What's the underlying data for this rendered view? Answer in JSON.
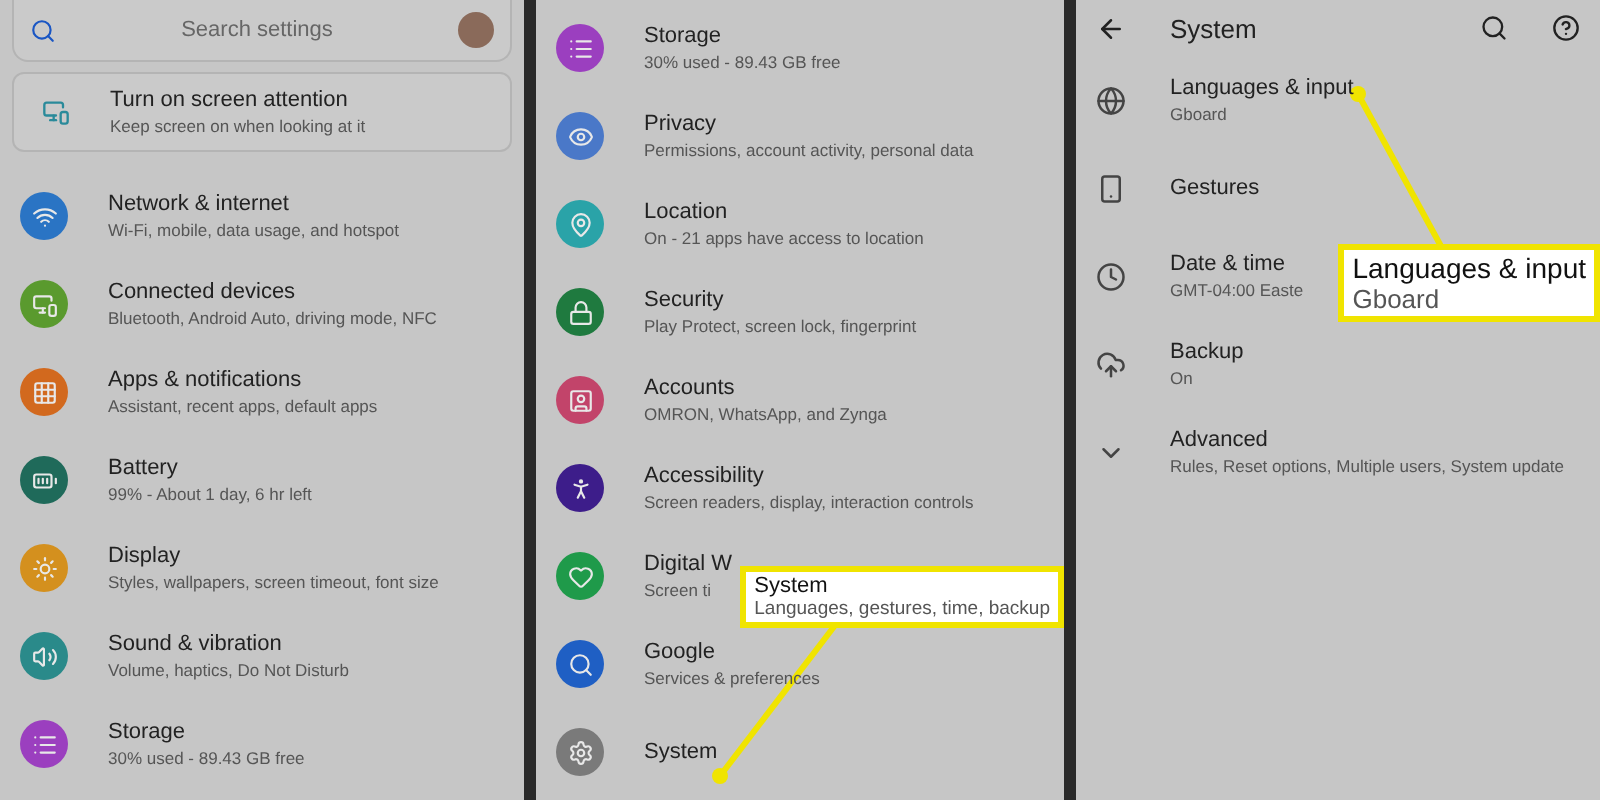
{
  "panels": [
    {
      "kind": "home",
      "search": {
        "placeholder": "Search settings"
      },
      "suggestion": {
        "title": "Turn on screen attention",
        "subtitle": "Keep screen on when looking at it"
      },
      "items": [
        {
          "title": "Network & internet",
          "subtitle": "Wi-Fi, mobile, data usage, and hotspot",
          "color": "#2a74c4"
        },
        {
          "title": "Connected devices",
          "subtitle": "Bluetooth, Android Auto, driving mode, NFC",
          "color": "#5a9a2e"
        },
        {
          "title": "Apps & notifications",
          "subtitle": "Assistant, recent apps, default apps",
          "color": "#d2691e"
        },
        {
          "title": "Battery",
          "subtitle": "99% - About 1 day, 6 hr left",
          "color": "#1f6a5a"
        },
        {
          "title": "Display",
          "subtitle": "Styles, wallpapers, screen timeout, font size",
          "color": "#d4901e"
        },
        {
          "title": "Sound & vibration",
          "subtitle": "Volume, haptics, Do Not Disturb",
          "color": "#2a8a8a"
        },
        {
          "title": "Storage",
          "subtitle": "30% used - 89.43 GB free",
          "color": "#9b3fbf"
        }
      ]
    },
    {
      "kind": "list",
      "items": [
        {
          "title": "Storage",
          "subtitle": "30% used - 89.43 GB free",
          "color": "#9b3fbf"
        },
        {
          "title": "Privacy",
          "subtitle": "Permissions, account activity, personal data",
          "color": "#4a78c8"
        },
        {
          "title": "Location",
          "subtitle": "On - 21 apps have access to location",
          "color": "#2aa3a8"
        },
        {
          "title": "Security",
          "subtitle": "Play Protect, screen lock, fingerprint",
          "color": "#1f7a3f"
        },
        {
          "title": "Accounts",
          "subtitle": "OMRON, WhatsApp, and Zynga",
          "color": "#c2446a"
        },
        {
          "title": "Accessibility",
          "subtitle": "Screen readers, display, interaction controls",
          "color": "#3d1d8a"
        },
        {
          "title": "Digital W",
          "subtitle": "Screen ti",
          "color": "#1f9a4a"
        },
        {
          "title": "Google",
          "subtitle": "Services & preferences",
          "color": "#1f5fc4"
        },
        {
          "title": "System",
          "color": "#7a7a7a"
        }
      ],
      "callout": {
        "title": "System",
        "subtitle": "Languages, gestures, time, backup"
      }
    },
    {
      "kind": "system",
      "header": {
        "title": "System"
      },
      "items": [
        {
          "title": "Languages & input",
          "subtitle": "Gboard"
        },
        {
          "title": "Gestures"
        },
        {
          "title": "Date & time",
          "subtitle": "GMT-04:00 Easte"
        },
        {
          "title": "Backup",
          "subtitle": "On"
        },
        {
          "title": "Advanced",
          "subtitle": "Rules, Reset options, Multiple users, System update"
        }
      ],
      "callout": {
        "title": "Languages & input",
        "subtitle": "Gboard"
      }
    }
  ]
}
